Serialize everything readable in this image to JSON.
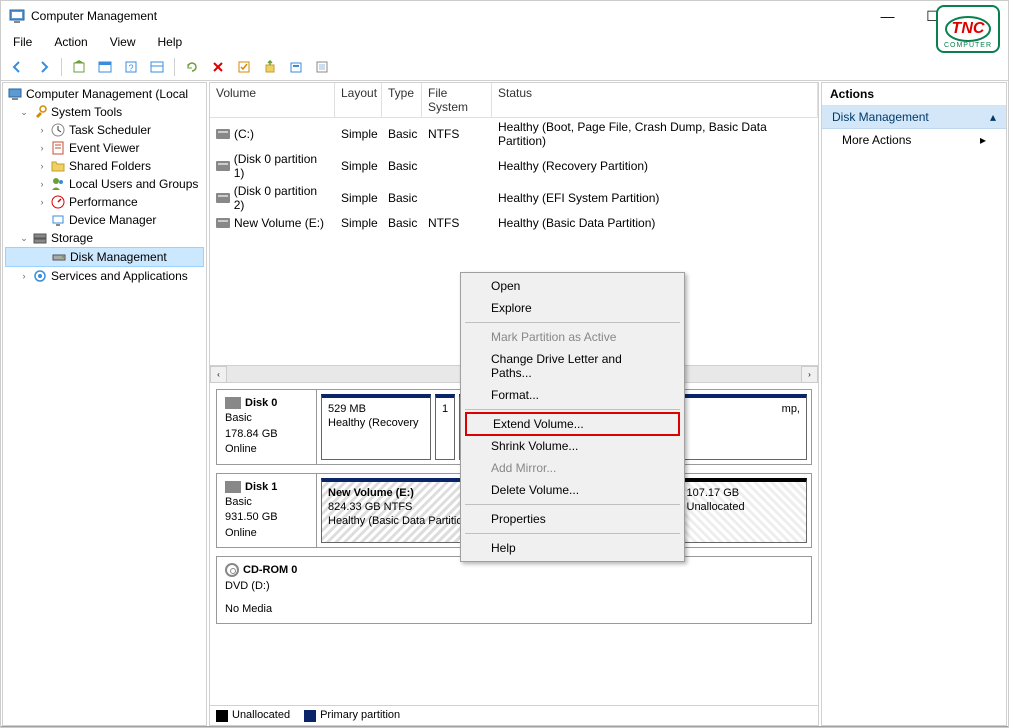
{
  "window": {
    "title": "Computer Management"
  },
  "menu": {
    "file": "File",
    "action": "Action",
    "view": "View",
    "help": "Help"
  },
  "tree": {
    "root": "Computer Management (Local",
    "systemTools": "System Tools",
    "taskScheduler": "Task Scheduler",
    "eventViewer": "Event Viewer",
    "sharedFolders": "Shared Folders",
    "localUsers": "Local Users and Groups",
    "performance": "Performance",
    "deviceManager": "Device Manager",
    "storage": "Storage",
    "diskManagement": "Disk Management",
    "services": "Services and Applications"
  },
  "volumeList": {
    "headers": {
      "volume": "Volume",
      "layout": "Layout",
      "type": "Type",
      "fileSystem": "File System",
      "status": "Status"
    },
    "rows": [
      {
        "volume": "(C:)",
        "layout": "Simple",
        "type": "Basic",
        "fs": "NTFS",
        "status": "Healthy (Boot, Page File, Crash Dump, Basic Data Partition)"
      },
      {
        "volume": "(Disk 0 partition 1)",
        "layout": "Simple",
        "type": "Basic",
        "fs": "",
        "status": "Healthy (Recovery Partition)"
      },
      {
        "volume": "(Disk 0 partition 2)",
        "layout": "Simple",
        "type": "Basic",
        "fs": "",
        "status": "Healthy (EFI System Partition)"
      },
      {
        "volume": "New Volume (E:)",
        "layout": "Simple",
        "type": "Basic",
        "fs": "NTFS",
        "status": "Healthy (Basic Data Partition)"
      }
    ]
  },
  "disks": {
    "disk0": {
      "name": "Disk 0",
      "type": "Basic",
      "size": "178.84 GB",
      "status": "Online",
      "partitions": [
        {
          "label1": "529 MB",
          "label2": "Healthy (Recovery"
        },
        {
          "label1": "1"
        },
        {
          "label1": "mp,"
        }
      ]
    },
    "disk1": {
      "name": "Disk 1",
      "type": "Basic",
      "size": "931.50 GB",
      "status": "Online",
      "partitions": [
        {
          "label1": "New Volume  (E:)",
          "label2": "824.33 GB NTFS",
          "label3": "Healthy (Basic Data Partition)"
        },
        {
          "label1": "107.17 GB",
          "label2": "Unallocated"
        }
      ]
    },
    "cdrom": {
      "name": "CD-ROM 0",
      "type": "DVD (D:)",
      "status": "No Media"
    }
  },
  "legend": {
    "unallocated": "Unallocated",
    "primary": "Primary partition"
  },
  "actions": {
    "title": "Actions",
    "section": "Disk Management",
    "moreActions": "More Actions"
  },
  "contextMenu": {
    "open": "Open",
    "explore": "Explore",
    "markActive": "Mark Partition as Active",
    "changeLetter": "Change Drive Letter and Paths...",
    "format": "Format...",
    "extend": "Extend Volume...",
    "shrink": "Shrink Volume...",
    "addMirror": "Add Mirror...",
    "delete": "Delete Volume...",
    "properties": "Properties",
    "help": "Help"
  },
  "logo": {
    "text": "TNC",
    "sub": "COMPUTER"
  }
}
